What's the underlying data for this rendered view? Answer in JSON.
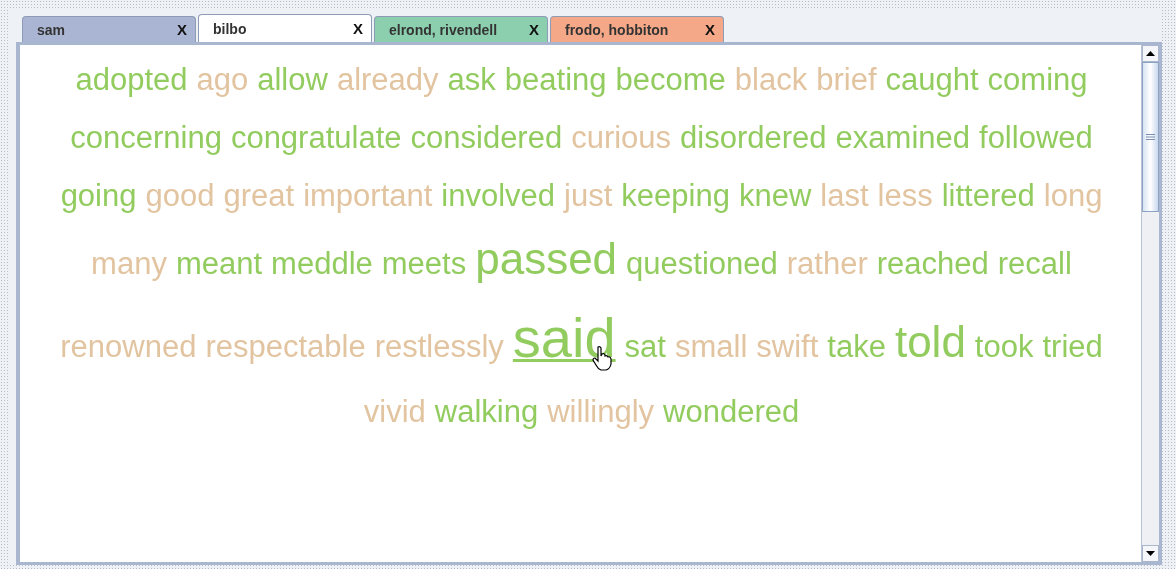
{
  "tabs": [
    {
      "label": "sam",
      "close": "X",
      "selected": false,
      "color": "#aab5d3"
    },
    {
      "label": "bilbo",
      "close": "X",
      "selected": true,
      "color": "#ffffff"
    },
    {
      "label": "elrond, rivendell",
      "close": "X",
      "selected": false,
      "color": "#8ccfae"
    },
    {
      "label": "frodo, hobbiton",
      "close": "X",
      "selected": false,
      "color": "#f5a888"
    }
  ],
  "words": [
    {
      "text": "adopted",
      "color": "#92cc5f",
      "kind": "normal"
    },
    {
      "text": "ago",
      "color": "#e2c4a0",
      "kind": "normal"
    },
    {
      "text": "allow",
      "color": "#92cc5f",
      "kind": "normal"
    },
    {
      "text": "already",
      "color": "#e2c4a0",
      "kind": "normal"
    },
    {
      "text": "ask",
      "color": "#92cc5f",
      "kind": "normal"
    },
    {
      "text": "beating",
      "color": "#92cc5f",
      "kind": "normal"
    },
    {
      "text": "become",
      "color": "#92cc5f",
      "kind": "normal"
    },
    {
      "text": "black",
      "color": "#e2c4a0",
      "kind": "normal"
    },
    {
      "text": "brief",
      "color": "#e2c4a0",
      "kind": "normal"
    },
    {
      "text": "caught",
      "color": "#92cc5f",
      "kind": "normal"
    },
    {
      "text": "coming",
      "color": "#92cc5f",
      "kind": "normal"
    },
    {
      "text": "concerning",
      "color": "#92cc5f",
      "kind": "normal"
    },
    {
      "text": "congratulate",
      "color": "#92cc5f",
      "kind": "normal"
    },
    {
      "text": "considered",
      "color": "#92cc5f",
      "kind": "normal"
    },
    {
      "text": "curious",
      "color": "#e2c4a0",
      "kind": "normal"
    },
    {
      "text": "disordered",
      "color": "#92cc5f",
      "kind": "normal"
    },
    {
      "text": "examined",
      "color": "#92cc5f",
      "kind": "normal"
    },
    {
      "text": "followed",
      "color": "#92cc5f",
      "kind": "normal"
    },
    {
      "text": "going",
      "color": "#92cc5f",
      "kind": "normal"
    },
    {
      "text": "good",
      "color": "#e2c4a0",
      "kind": "normal"
    },
    {
      "text": "great",
      "color": "#e2c4a0",
      "kind": "normal"
    },
    {
      "text": "important",
      "color": "#e2c4a0",
      "kind": "normal"
    },
    {
      "text": "involved",
      "color": "#92cc5f",
      "kind": "normal"
    },
    {
      "text": "just",
      "color": "#e2c4a0",
      "kind": "normal"
    },
    {
      "text": "keeping",
      "color": "#92cc5f",
      "kind": "normal"
    },
    {
      "text": "knew",
      "color": "#92cc5f",
      "kind": "normal"
    },
    {
      "text": "last",
      "color": "#e2c4a0",
      "kind": "normal"
    },
    {
      "text": "less",
      "color": "#e2c4a0",
      "kind": "normal"
    },
    {
      "text": "littered",
      "color": "#92cc5f",
      "kind": "normal"
    },
    {
      "text": "long",
      "color": "#e2c4a0",
      "kind": "normal"
    },
    {
      "text": "many",
      "color": "#e2c4a0",
      "kind": "normal"
    },
    {
      "text": "meant",
      "color": "#92cc5f",
      "kind": "normal"
    },
    {
      "text": "meddle",
      "color": "#92cc5f",
      "kind": "normal"
    },
    {
      "text": "meets",
      "color": "#92cc5f",
      "kind": "normal"
    },
    {
      "text": "passed",
      "color": "#92cc5f",
      "kind": "large"
    },
    {
      "text": "questioned",
      "color": "#92cc5f",
      "kind": "normal"
    },
    {
      "text": "rather",
      "color": "#e2c4a0",
      "kind": "normal"
    },
    {
      "text": "reached",
      "color": "#92cc5f",
      "kind": "normal"
    },
    {
      "text": "recall",
      "color": "#92cc5f",
      "kind": "normal"
    },
    {
      "text": "renowned",
      "color": "#e2c4a0",
      "kind": "normal"
    },
    {
      "text": "respectable",
      "color": "#e2c4a0",
      "kind": "normal"
    },
    {
      "text": "restlessly",
      "color": "#e2c4a0",
      "kind": "normal"
    },
    {
      "text": "said",
      "color": "#92cc5f",
      "kind": "largest",
      "hovered": true
    },
    {
      "text": "sat",
      "color": "#92cc5f",
      "kind": "normal"
    },
    {
      "text": "small",
      "color": "#e2c4a0",
      "kind": "normal"
    },
    {
      "text": "swift",
      "color": "#e2c4a0",
      "kind": "normal"
    },
    {
      "text": "take",
      "color": "#92cc5f",
      "kind": "normal"
    },
    {
      "text": "told",
      "color": "#92cc5f",
      "kind": "large"
    },
    {
      "text": "took",
      "color": "#92cc5f",
      "kind": "normal"
    },
    {
      "text": "tried",
      "color": "#92cc5f",
      "kind": "normal"
    },
    {
      "text": "vivid",
      "color": "#e2c4a0",
      "kind": "normal"
    },
    {
      "text": "walking",
      "color": "#92cc5f",
      "kind": "normal"
    },
    {
      "text": "willingly",
      "color": "#e2c4a0",
      "kind": "normal"
    },
    {
      "text": "wondered",
      "color": "#92cc5f",
      "kind": "normal"
    }
  ]
}
